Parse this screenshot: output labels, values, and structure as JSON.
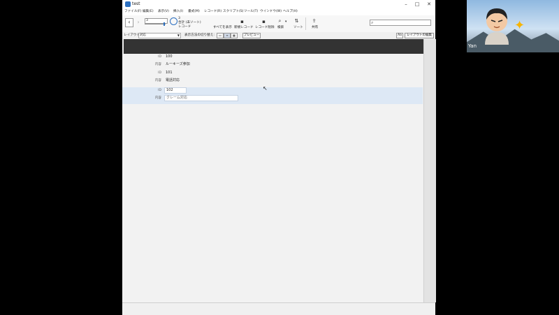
{
  "window": {
    "title": "test"
  },
  "menu": [
    "ファイル(F)",
    "編集(E)",
    "表示(V)",
    "挿入(I)",
    "書式(M)",
    "レコード(R)",
    "スクリプト(S)",
    "ツール(T)",
    "ウインドウ(W)",
    "ヘルプ(H)"
  ],
  "toolbar": {
    "record_number": "3",
    "record_count": "3",
    "total_label": "合計 (未ソート)",
    "records_label": "レコード",
    "show_all": "すべてを表示",
    "new_record": "新規レコード",
    "delete_record": "レコード削除",
    "find": "検索",
    "sort": "ソート",
    "share": "共有"
  },
  "layoutbar": {
    "layout_label": "レイアウト:",
    "layout_value": "対応",
    "view_as_label": "表示方法の切り替え:",
    "preview": "プレビュー",
    "aa": "Aa",
    "edit_layout": "レイアウトの編集"
  },
  "records": [
    {
      "id_label": "ID",
      "id": "100",
      "content_label": "内容",
      "content": "ルーキーズ参加"
    },
    {
      "id_label": "ID",
      "id": "101",
      "content_label": "内容",
      "content": "電話対応"
    },
    {
      "id_label": "ID",
      "id": "102",
      "content_label": "内容",
      "content": "クレーム対応"
    }
  ],
  "active_record": 3,
  "camera": {
    "name": "Yan"
  }
}
